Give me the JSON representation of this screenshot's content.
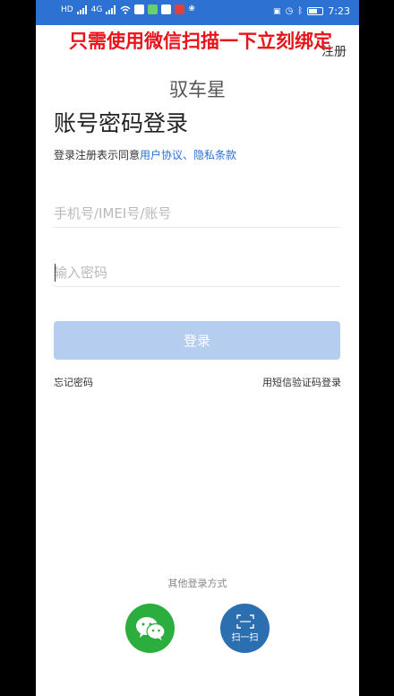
{
  "status_bar": {
    "left_labels": [
      "HD",
      "4G",
      "4G"
    ],
    "time": "7:23",
    "icons": [
      "signal-icon",
      "wifi-icon",
      "nfc-icon",
      "alarm-icon",
      "bluetooth-icon",
      "battery-icon"
    ]
  },
  "overlay_banner": "只需使用微信扫描一下立刻绑定",
  "header": {
    "register_label": "注册"
  },
  "app_name": "驭车星",
  "login": {
    "title": "账号密码登录",
    "agreement_prefix": "登录注册表示同意",
    "user_agreement": "用户协议",
    "separator": "、",
    "privacy_terms": "隐私条款",
    "account_placeholder": "手机号/IMEI号/账号",
    "password_placeholder": "输入密码",
    "submit_label": "登录",
    "forgot_password": "忘记密码",
    "sms_login": "用短信验证码登录"
  },
  "other_login": {
    "title": "其他登录方式",
    "scan_label": "扫一扫"
  },
  "colors": {
    "status_bar": "#2d72d2",
    "banner_text": "#e8141c",
    "link": "#2d6fd6",
    "login_button": "#b5cdef",
    "wechat": "#2bae3d",
    "scan": "#2b6fb0"
  }
}
